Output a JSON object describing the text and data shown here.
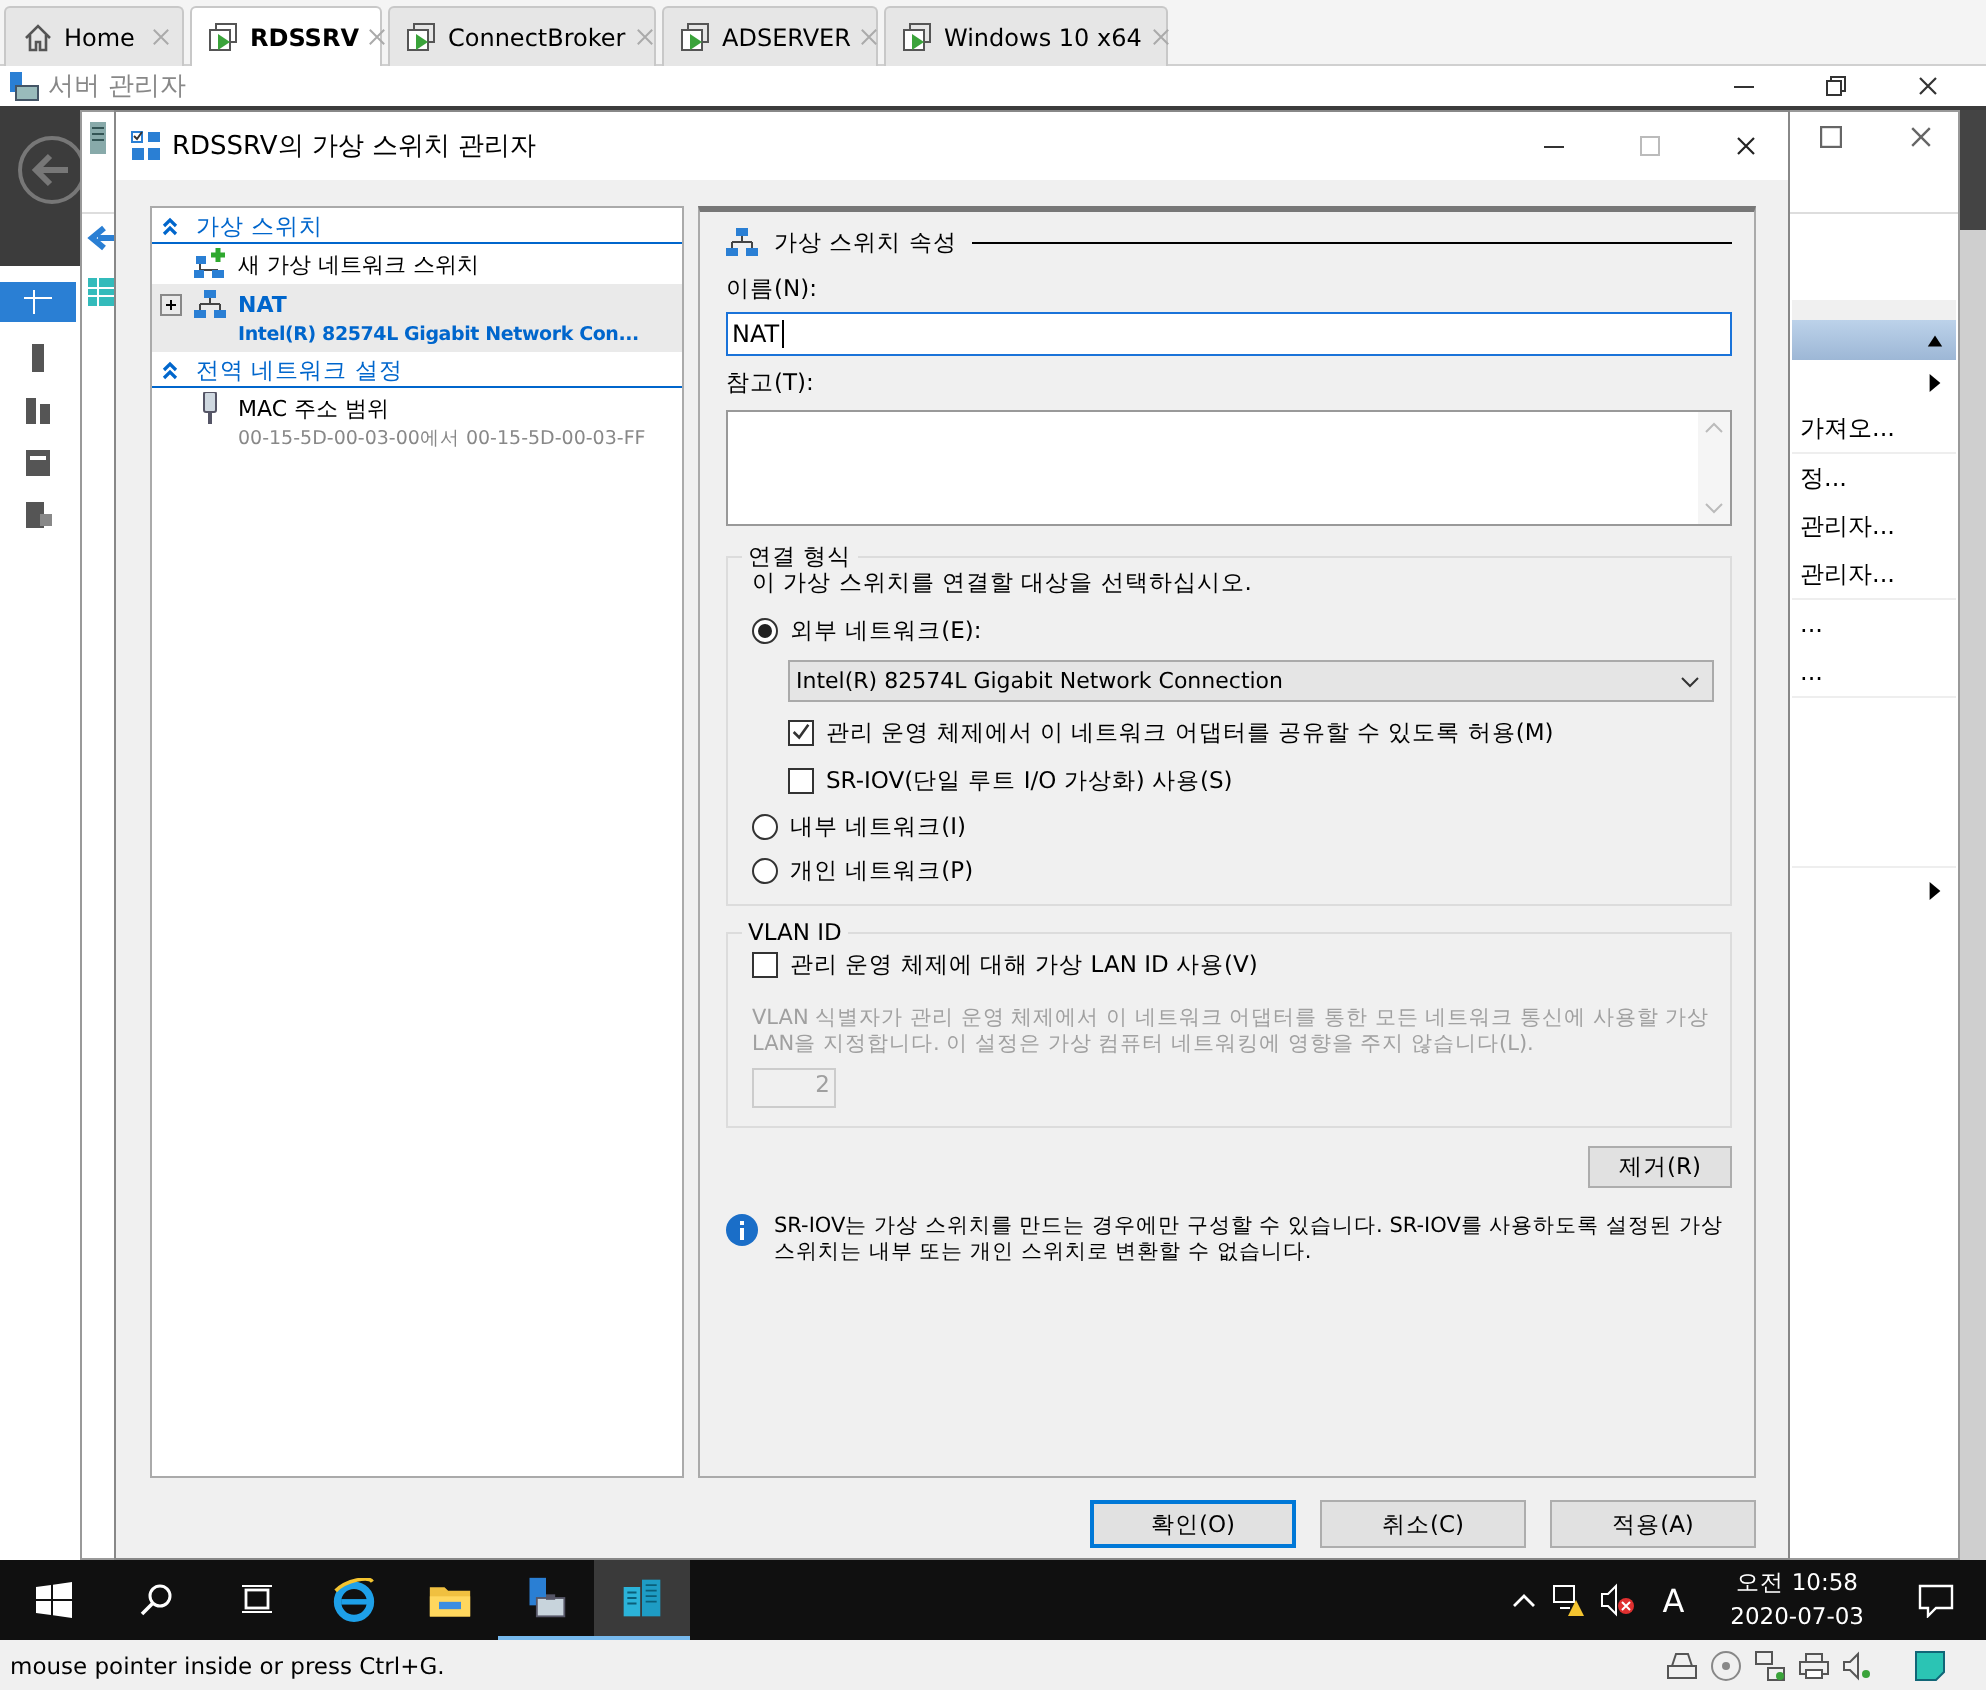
{
  "vm_tabs": [
    {
      "label": "Home",
      "kind": "home",
      "selected": false
    },
    {
      "label": "RDSSRV",
      "kind": "vm",
      "selected": true
    },
    {
      "label": "ConnectBroker",
      "kind": "vm",
      "selected": false
    },
    {
      "label": "ADSERVER",
      "kind": "vm",
      "selected": false
    },
    {
      "label": "Windows 10 x64",
      "kind": "vm",
      "selected": false
    }
  ],
  "server_manager": {
    "title": "서버 관리자",
    "task_items": [
      {
        "label": "가져오..."
      },
      {
        "label": "정..."
      },
      {
        "label": "관리자..."
      },
      {
        "label": "관리자..."
      },
      {
        "label": "..."
      },
      {
        "label": "..."
      }
    ]
  },
  "dialog": {
    "title": "RDSSRV의 가상 스위치 관리자",
    "tree": [
      {
        "label": "가상 스위치",
        "expanded": true,
        "items": [
          {
            "kind": "new",
            "label": "새 가상 네트워크 스위치",
            "selected": false
          },
          {
            "kind": "switch",
            "label": "NAT",
            "detail": "Intel(R) 82574L Gigabit Network Con...",
            "selected": true,
            "expanded": false
          }
        ]
      },
      {
        "label": "전역 네트워크 설정",
        "expanded": true,
        "items": [
          {
            "kind": "mac",
            "label": "MAC 주소 범위",
            "detail": "00-15-5D-00-03-00에서 00-15-5D-00-03-FF",
            "selected": false
          }
        ]
      }
    ],
    "properties": {
      "heading": "가상 스위치 속성",
      "name_label": "이름(N):",
      "name_value": "NAT",
      "notes_label": "참고(T):",
      "connection": {
        "legend": "연결 형식",
        "prompt": "이 가상 스위치를 연결할 대상을 선택하십시오.",
        "options": [
          {
            "label": "외부 네트워크(E):",
            "selected": true,
            "adapter": "Intel(R) 82574L Gigabit Network Connection",
            "checks": [
              {
                "label": "관리 운영 체제에서 이 네트워크 어댑터를 공유할 수 있도록 허용(M)",
                "checked": true
              },
              {
                "label": "SR-IOV(단일 루트 I/O 가상화) 사용(S)",
                "checked": false
              }
            ]
          },
          {
            "label": "내부 네트워크(I)",
            "selected": false
          },
          {
            "label": "개인 네트워크(P)",
            "selected": false
          }
        ]
      },
      "vlan": {
        "legend": "VLAN ID",
        "check_label": "관리 운영 체제에 대해 가상 LAN ID 사용(V)",
        "checked": false,
        "description": "VLAN 식별자가 관리 운영 체제에서 이 네트워크 어댑터를 통한 모든 네트워크 통신에 사용할 가상 LAN을 지정합니다. 이 설정은 가상 컴퓨터 네트워킹에 영향을 주지 않습니다(L).",
        "value": "2"
      },
      "remove_button": "제거(R)",
      "info": "SR-IOV는 가상 스위치를 만드는 경우에만 구성할 수 있습니다. SR-IOV를 사용하도록 설정된 가상 스위치는 내부 또는 개인 스위치로 변환할 수 없습니다."
    },
    "buttons": [
      {
        "label": "확인(O)",
        "selected": true
      },
      {
        "label": "취소(C)",
        "selected": false
      },
      {
        "label": "적용(A)",
        "selected": false
      }
    ]
  },
  "taskbar": {
    "ime": "A",
    "ampm": "오전",
    "time": "10:58",
    "date": "2020-07-03"
  },
  "status_bar": {
    "text": "mouse pointer inside or press Ctrl+G."
  }
}
